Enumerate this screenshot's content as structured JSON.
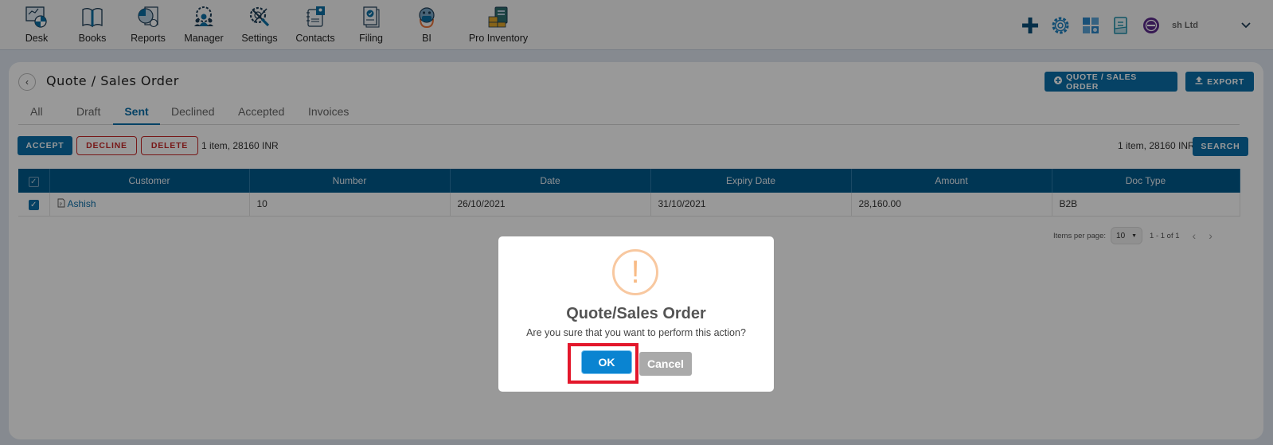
{
  "nav": {
    "items": [
      {
        "label": "Desk",
        "icon": "desk-icon"
      },
      {
        "label": "Books",
        "icon": "books-icon"
      },
      {
        "label": "Reports",
        "icon": "reports-icon"
      },
      {
        "label": "Manager",
        "icon": "manager-icon"
      },
      {
        "label": "Settings",
        "icon": "settings-icon"
      },
      {
        "label": "Contacts",
        "icon": "contacts-icon"
      },
      {
        "label": "Filing",
        "icon": "filing-icon"
      },
      {
        "label": "BI",
        "icon": "bi-robot-icon"
      },
      {
        "label": "Pro Inventory",
        "icon": "pro-inventory-icon"
      }
    ],
    "right": {
      "icons": [
        "plus-icon",
        "gear-icon",
        "calculator-icon",
        "document-icon",
        "badge-icon"
      ],
      "company": "sh Ltd",
      "dropdown_icon": "chevron-down-icon"
    }
  },
  "page": {
    "title": "Quote / Sales Order",
    "new_button": "QUOTE / SALES ORDER",
    "export_button": "EXPORT",
    "tabs": [
      "All",
      "Draft",
      "Sent",
      "Declined",
      "Accepted",
      "Invoices"
    ],
    "active_tab": "Sent",
    "actions": {
      "accept": "ACCEPT",
      "decline": "DECLINE",
      "delete": "DELETE"
    },
    "summary_left": "1 item, 28160 INR",
    "summary_right": "1 item, 28160 INR",
    "search_button": "SEARCH"
  },
  "table": {
    "columns": [
      "Customer",
      "Number",
      "Date",
      "Expiry Date",
      "Amount",
      "Doc Type"
    ],
    "rows": [
      {
        "selected": true,
        "customer": "Ashish",
        "number": "10",
        "date": "26/10/2021",
        "expiry": "31/10/2021",
        "amount": "28,160.00",
        "doc_type": "B2B"
      }
    ]
  },
  "pagination": {
    "label": "Items per page:",
    "per_page": "10",
    "range": "1 - 1 of 1"
  },
  "dialog": {
    "title": "Quote/Sales Order",
    "message": "Are you sure that you want to perform this action?",
    "ok": "OK",
    "cancel": "Cancel",
    "icon_glyph": "!"
  }
}
